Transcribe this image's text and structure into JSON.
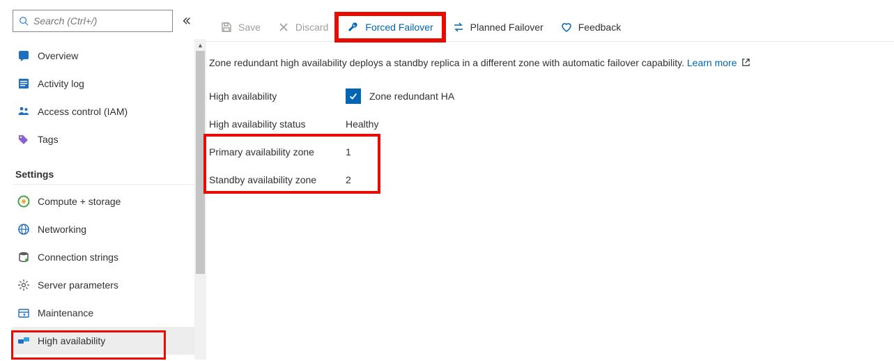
{
  "sidebar": {
    "search_placeholder": "Search (Ctrl+/)",
    "items_top": [
      {
        "icon": "overview",
        "label": "Overview"
      },
      {
        "icon": "activity",
        "label": "Activity log"
      },
      {
        "icon": "iam",
        "label": "Access control (IAM)"
      },
      {
        "icon": "tags",
        "label": "Tags"
      }
    ],
    "settings_heading": "Settings",
    "items_settings": [
      {
        "icon": "compute",
        "label": "Compute + storage"
      },
      {
        "icon": "network",
        "label": "Networking"
      },
      {
        "icon": "connstr",
        "label": "Connection strings"
      },
      {
        "icon": "params",
        "label": "Server parameters"
      },
      {
        "icon": "maint",
        "label": "Maintenance"
      },
      {
        "icon": "ha",
        "label": "High availability"
      }
    ]
  },
  "toolbar": {
    "save": "Save",
    "discard": "Discard",
    "forced_failover": "Forced Failover",
    "planned_failover": "Planned Failover",
    "feedback": "Feedback"
  },
  "main": {
    "description": "Zone redundant high availability deploys a standby replica in a different zone with automatic failover capability.",
    "learn_more": "Learn more",
    "rows": {
      "ha_label": "High availability",
      "ha_value": "Zone redundant HA",
      "status_label": "High availability status",
      "status_value": "Healthy",
      "primary_label": "Primary availability zone",
      "primary_value": "1",
      "standby_label": "Standby availability zone",
      "standby_value": "2"
    }
  }
}
